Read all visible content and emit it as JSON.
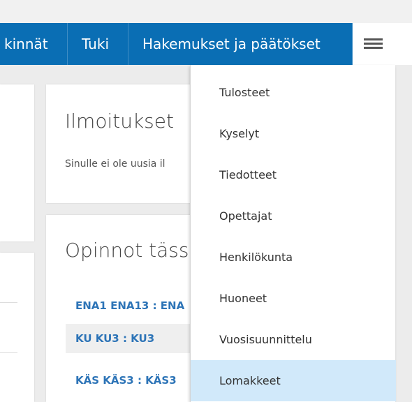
{
  "navbar": {
    "items": [
      {
        "label": "kinnät"
      },
      {
        "label": "Tuki"
      },
      {
        "label": "Hakemukset ja päätökset"
      }
    ],
    "menu_icon": "hamburger-menu-icon",
    "color": "#0a6eb4"
  },
  "notices": {
    "title": "Ilmoitukset",
    "text": "Sinulle ei ole uusia il"
  },
  "studies": {
    "title": "Opinnot täss",
    "courses": [
      {
        "label": "ENA1 ENA13 : ENA"
      },
      {
        "label": "KU KU3 : KU3"
      },
      {
        "label": "KÄS KÄS3 : KÄS3"
      }
    ]
  },
  "dropdown": {
    "items": [
      {
        "label": "Tulosteet"
      },
      {
        "label": "Kyselyt"
      },
      {
        "label": "Tiedotteet"
      },
      {
        "label": "Opettajat"
      },
      {
        "label": "Henkilökunta"
      },
      {
        "label": "Huoneet"
      },
      {
        "label": "Vuosisuunnittelu"
      },
      {
        "label": "Lomakkeet"
      }
    ],
    "active_item": "Lomakkeet",
    "active_color": "#d1e9fa"
  }
}
